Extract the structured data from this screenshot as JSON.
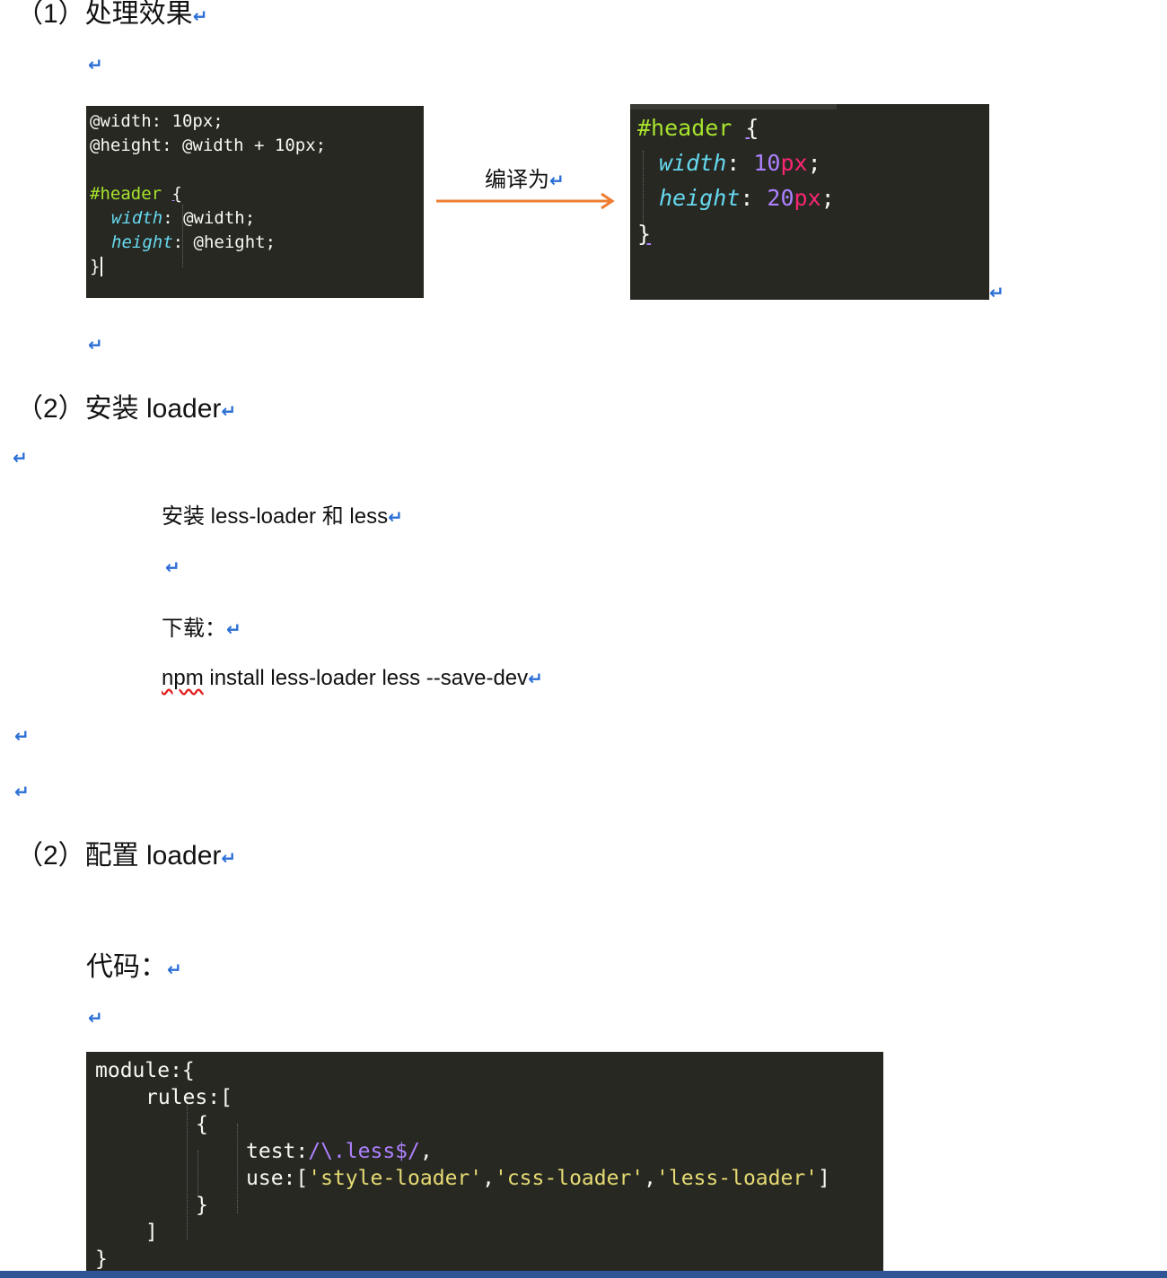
{
  "sections": {
    "s1_heading": "（1）处理效果",
    "s2_heading": "（2）安装 loader",
    "s3_heading": "（2）配置 loader"
  },
  "return_mark": "↵",
  "less_example": {
    "lines": [
      "@width: 10px;",
      "@height: @width + 10px;",
      "",
      "#header {",
      "  width: @width;",
      "  height: @height;",
      "}"
    ]
  },
  "compile_label": "编译为",
  "css_output": {
    "selector": "#header",
    "open_brace": "{",
    "close_brace": "}",
    "rules": [
      {
        "prop": "width",
        "num": "10",
        "unit": "px"
      },
      {
        "prop": "height",
        "num": "20",
        "unit": "px"
      }
    ]
  },
  "install": {
    "line1": "安装 less-loader 和 less",
    "line2": "下载：",
    "cmd_npm": "npm",
    "cmd_rest": " install less-loader less --save-dev"
  },
  "config": {
    "label": "代码：",
    "lines": {
      "module": "module:{",
      "rules": "rules:[",
      "open": "{",
      "test_key": "test:",
      "test_re": "/\\.less$/",
      "test_end": ",",
      "use_key": "use:[",
      "s1": "'style-loader'",
      "s2": "'css-loader'",
      "s3": "'less-loader'",
      "use_end": "]",
      "close": "}",
      "rules_close": "]",
      "module_close": "}"
    }
  },
  "colors": {
    "accent_arrow": "#ed7d31",
    "return_mark": "#2b6fd6",
    "code_bg": "#272822"
  }
}
